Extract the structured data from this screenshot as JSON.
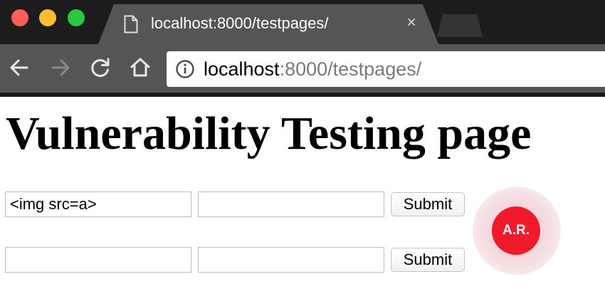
{
  "window": {
    "tab_title": "localhost:8000/testpages/",
    "tab_close": "×",
    "colors": {
      "close": "#ff5f57",
      "minimize": "#febc2e",
      "zoom": "#28c840"
    }
  },
  "toolbar": {
    "back_icon": "arrow-left-icon",
    "forward_icon": "arrow-right-icon",
    "reload_icon": "reload-icon",
    "home_icon": "home-icon",
    "info_icon": "info-icon",
    "url_host": "localhost",
    "url_rest": ":8000/testpages/"
  },
  "page": {
    "title": "Vulnerability Testing page",
    "forms": [
      {
        "field1_value": "<img src=a>",
        "field2_value": "",
        "submit_label": "Submit"
      },
      {
        "field1_value": "",
        "field2_value": "",
        "submit_label": "Submit"
      }
    ],
    "avatar": {
      "initials": "A.R.",
      "color": "#f01a2a"
    }
  }
}
